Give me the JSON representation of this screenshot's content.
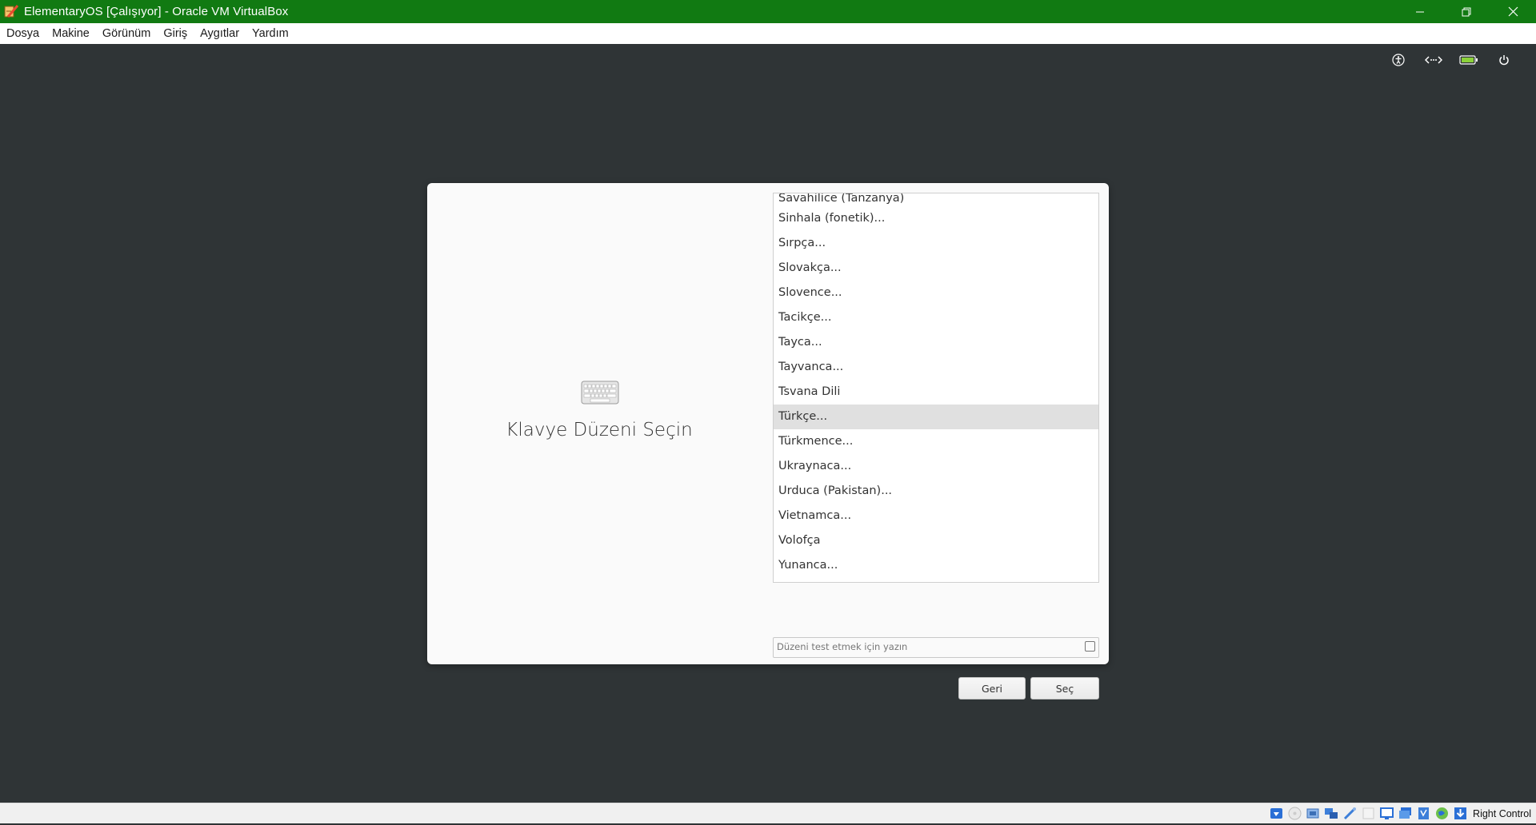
{
  "window": {
    "title": "ElementaryOS [Çalışıyor] - Oracle VM VirtualBox",
    "controls": [
      "minimize-icon",
      "restore-icon",
      "close-icon"
    ],
    "titlebar_color": "#117a12"
  },
  "menubar": {
    "items": [
      "Dosya",
      "Makine",
      "Görünüm",
      "Giriş",
      "Aygıtlar",
      "Yardım"
    ]
  },
  "tray": {
    "icons": [
      "accessibility-icon",
      "network-icon",
      "battery-icon",
      "power-icon"
    ]
  },
  "dialog": {
    "title": "Klavye Düzeni Seçin",
    "icon": "keyboard-icon",
    "layouts": [
      "Savahilice (Tanzanya)",
      "Sinhala (fonetik)...",
      "Sırpça...",
      "Slovakça...",
      "Slovence...",
      "Tacikçe...",
      "Tayca...",
      "Tayvanca...",
      "Tsvana Dili",
      "Türkçe...",
      "Türkmence...",
      "Ukraynaca...",
      "Urduca (Pakistan)...",
      "Vietnamca...",
      "Volofça",
      "Yunanca..."
    ],
    "selected_layout": "Türkçe...",
    "test_input": {
      "placeholder": "Düzeni test etmek için yazın",
      "value": ""
    },
    "back_label": "Geri",
    "select_label": "Seç"
  },
  "statusbar": {
    "icons": [
      "hard-disk-icon",
      "optical-disk-icon",
      "audio-icon",
      "network-adapter-icon",
      "usb-icon",
      "shared-folders-icon",
      "display-icon",
      "video-capture-icon",
      "cpu-icon",
      "mouse-integration-icon",
      "keyboard-capture-icon"
    ],
    "host_key_label": "Right Control"
  }
}
